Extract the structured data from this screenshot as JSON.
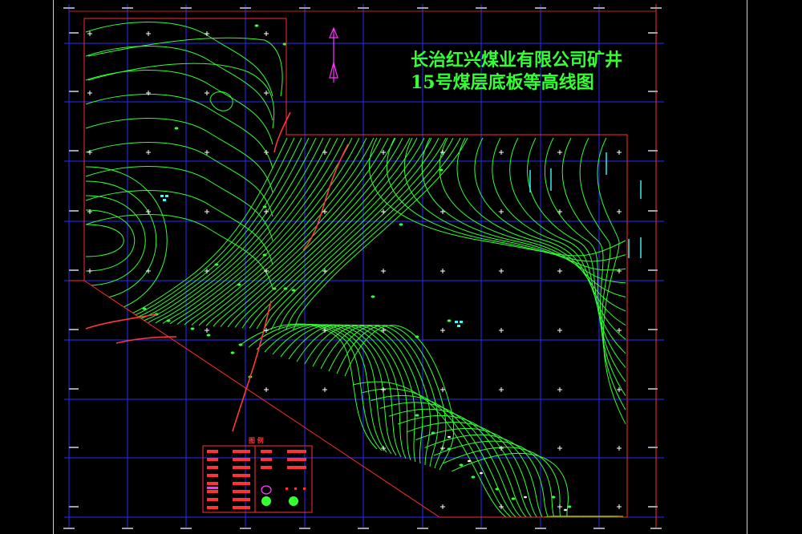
{
  "map": {
    "title_line1": "长治红兴煤业有限公司矿井",
    "title_line2": "15号煤层底板等高线图",
    "legend_title": "图  例",
    "colors": {
      "background": "#000000",
      "contour": "#33ff33",
      "grid": "#2b2bff",
      "boundary": "#ff2b2b",
      "fault": "#ff3a3a",
      "north_arrow": "#ff33ff",
      "borehole": "#33ffff",
      "crosshair": "#ffffff",
      "frame": "#cfcfcf"
    },
    "icons": [
      "north-arrow-icon",
      "borehole-icon",
      "crosshair-icon",
      "fault-line-icon"
    ]
  }
}
